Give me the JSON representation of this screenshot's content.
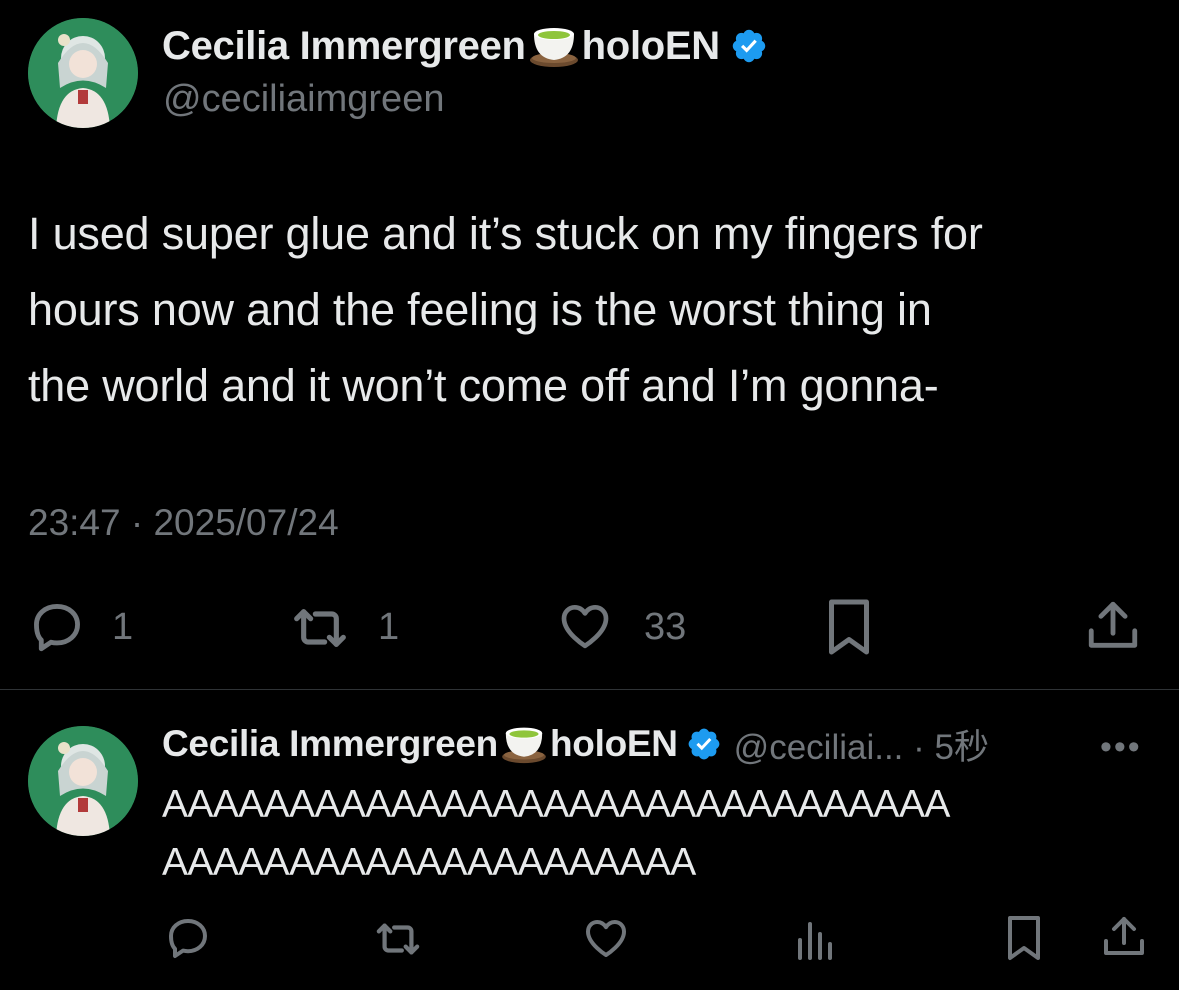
{
  "main_tweet": {
    "author_name": "Cecilia Immergreen",
    "author_suffix": "holoEN",
    "handle": "@ceciliaimgreen",
    "text_lines": [
      "I used super glue and it’s stuck on my fingers for",
      "hours now and the feeling is the worst thing in",
      "the world and it won’t come off and I’m gonna-"
    ],
    "timestamp": "23:47 · 2025/07/24",
    "reply_count": "1",
    "retweet_count": "1",
    "like_count": "33"
  },
  "reply_tweet": {
    "author_name": "Cecilia Immergreen",
    "author_suffix": "holoEN",
    "handle_time": "@ceciliai... · 5秒",
    "more_label": "•••",
    "text_lines": [
      "AAAAAAAAAAAAAAAAAAAAAAAAAAAAAAA",
      "AAAAAAAAAAAAAAAAAAAAA"
    ]
  },
  "icons": {
    "verified": "verified-badge-icon",
    "emoji": "green-tea-icon",
    "reply": "reply-icon",
    "retweet": "retweet-icon",
    "like": "heart-icon",
    "bookmark": "bookmark-icon",
    "share": "share-icon",
    "views": "views-icon"
  },
  "colors": {
    "background": "#000000",
    "text_primary": "#e7e9ea",
    "text_secondary": "#71767b",
    "verified_blue": "#1d9bf0",
    "divider": "#2f3336"
  }
}
